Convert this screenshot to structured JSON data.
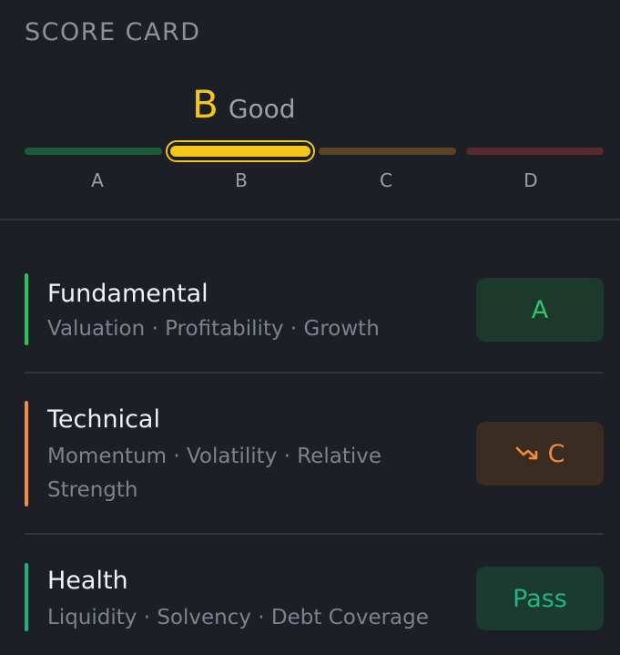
{
  "header": {
    "title": "SCORE CARD",
    "grade_letter": "B",
    "grade_word": "Good"
  },
  "scale": {
    "labels": [
      "A",
      "B",
      "C",
      "D"
    ],
    "selected": "B"
  },
  "rows": [
    {
      "title": "Fundamental",
      "subtitle": "Valuation · Profitability · Growth",
      "badge": "A",
      "accent": "#22c55e",
      "badge_bg": "#1c3a2c",
      "badge_color": "#34c26b"
    },
    {
      "title": "Technical",
      "subtitle": "Momentum · Volatility · Relative Strength",
      "badge": "C",
      "badge_icon": "trending-down-icon",
      "accent": "#f28c38",
      "badge_bg": "#3b2c22",
      "badge_color": "#f28c38"
    },
    {
      "title": "Health",
      "subtitle": "Liquidity · Solvency · Debt Coverage",
      "badge": "Pass",
      "accent": "#1fb37c",
      "badge_bg": "#1b3a30",
      "badge_color": "#22b57c"
    }
  ],
  "colors": {
    "background": "#1c1f25",
    "grade_yellow": "#f5c518",
    "divider": "#30353d"
  }
}
